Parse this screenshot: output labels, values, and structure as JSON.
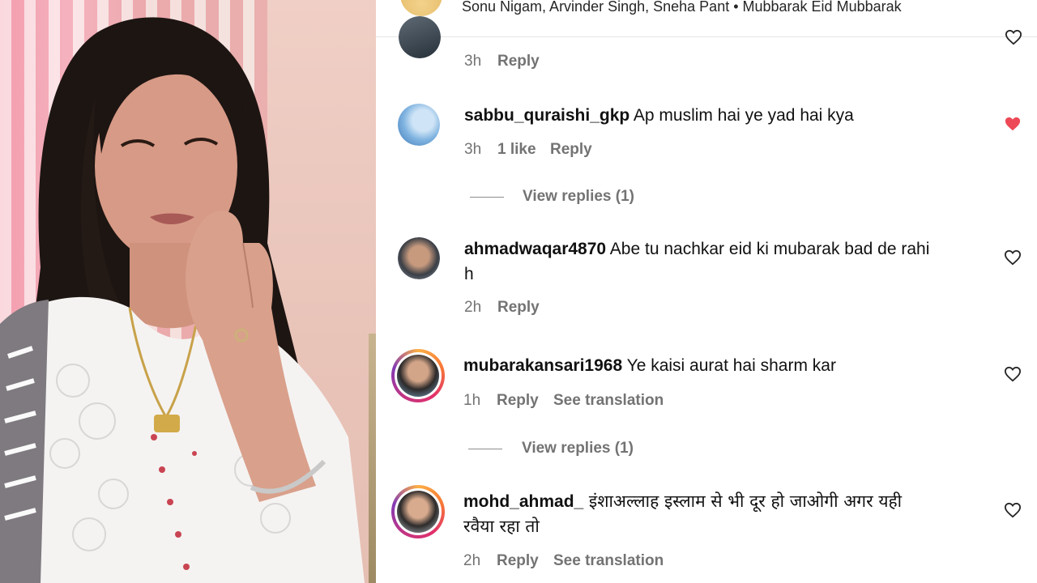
{
  "header": {
    "text": "Sonu Nigam, Arvinder Singh, Sneha Pant • Mubbarak Eid Mubbarak"
  },
  "comments": [
    {
      "username": "",
      "text": "",
      "time": "3h",
      "likes": "",
      "reply_label": "Reply",
      "liked": false
    },
    {
      "username": "sabbu_quraishi_gkp",
      "text": "Ap muslim hai ye yad hai kya",
      "time": "3h",
      "likes": "1 like",
      "reply_label": "Reply",
      "liked": true,
      "view_replies": "View replies (1)"
    },
    {
      "username": "ahmadwaqar4870",
      "text_line1": "Abe tu nachkar eid ki mubarak bad de rahi",
      "text_line2": "h",
      "time": "2h",
      "reply_label": "Reply",
      "liked": false
    },
    {
      "username": "mubarakansari1968",
      "text": "Ye kaisi aurat hai sharm kar",
      "time": "1h",
      "reply_label": "Reply",
      "translate_label": "See translation",
      "liked": false,
      "view_replies": "View replies (1)"
    },
    {
      "username": "mohd_ahmad_",
      "text_line1": "इंशाअल्लाह इस्लाम से भी दूर हो जाओगी अगर यही",
      "text_line2": "रवैया रहा तो",
      "time": "2h",
      "reply_label": "Reply",
      "translate_label": "See translation",
      "liked": false
    }
  ],
  "colors": {
    "liked_heart": "#ed4956",
    "meta_text": "#737373",
    "story_ring": "#e1306c"
  }
}
